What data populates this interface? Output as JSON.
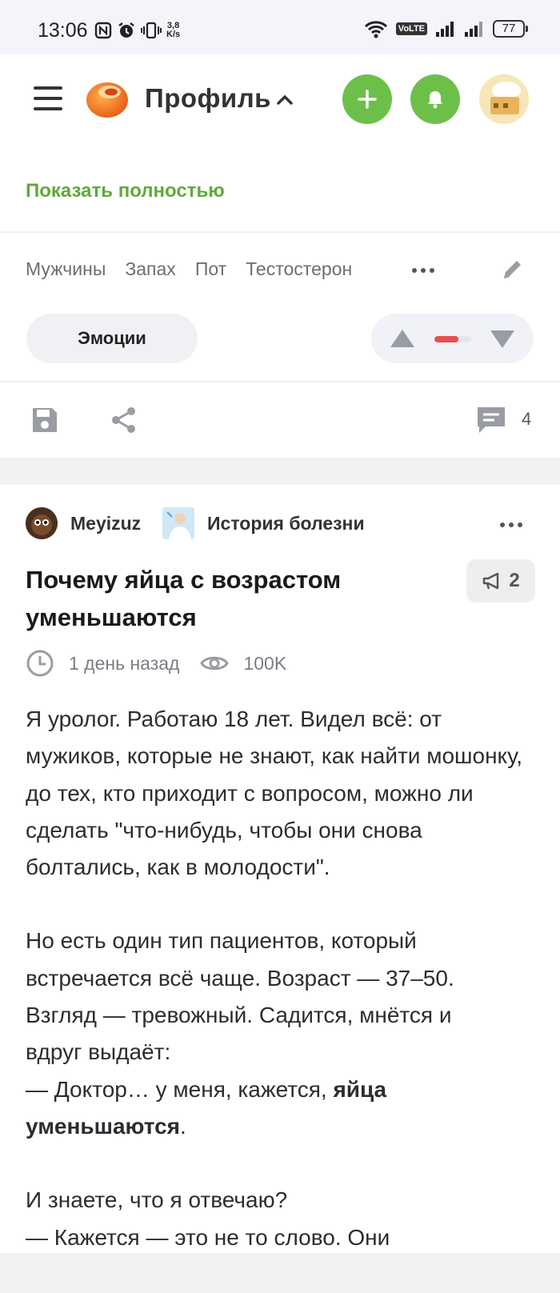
{
  "status_bar": {
    "time": "13:06",
    "net_speed_value": "3,8",
    "net_speed_unit": "K/s",
    "volte": "VoLTE",
    "battery": "77"
  },
  "header": {
    "title": "Профиль"
  },
  "prev_post": {
    "show_full": "Показать полностью",
    "tags": [
      "Мужчины",
      "Запах",
      "Пот",
      "Тестостерон"
    ],
    "emotion_label": "Эмоции",
    "rating_negative_fraction": 0.65,
    "comment_count": "4"
  },
  "post": {
    "author": "Meyizuz",
    "community": "История болезни",
    "title": "Почему яйца с возрастом уменьшаются",
    "badge_count": "2",
    "time_ago": "1 день назад",
    "views": "100K",
    "p1": "Я уролог. Работаю 18 лет. Видел всё: от мужиков, которые не знают, как найти мошонку, до тех, кто приходит с вопросом, можно ли сделать \"что-нибудь, чтобы они снова болтались, как в молодости\".",
    "p2_lines": [
      "Но есть один тип пациентов, который",
      "встречается всё чаще. Возраст — 37–50.",
      "Взгляд — тревожный. Садится, мнётся и",
      "вдруг выдаёт:"
    ],
    "p2_quote_start": "— Доктор… у меня, кажется, ",
    "p2_bold_1": "яйца",
    "p2_bold_2": "уменьшаются",
    "p2_end": ".",
    "p3_line1": "И знаете, что я отвечаю?",
    "p3_line2": "— Кажется — это не то слово. Они"
  },
  "colors": {
    "accent_green": "#6cc04a",
    "link_green": "#61a93a",
    "rating_red": "#e55050"
  }
}
